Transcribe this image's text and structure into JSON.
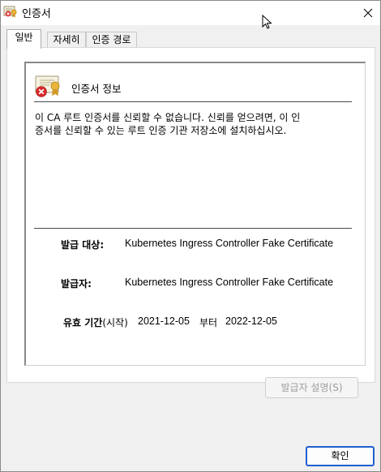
{
  "window": {
    "title": "인증서"
  },
  "tabs": [
    {
      "label": "일반",
      "active": true
    },
    {
      "label": "자세히",
      "active": false
    },
    {
      "label": "인증 경로",
      "active": false
    }
  ],
  "certificate": {
    "info_title": "인증서 정보",
    "warning_lines": [
      "이 CA 루트 인증서를 신뢰할 수 없습니다. 신뢰를 얻으려면, 이 인",
      "증서를 신뢰할 수 있는 루트 인증 기관 저장소에 설치하십시오."
    ],
    "issued_to_label": "발급 대상:",
    "issued_to_value": "Kubernetes Ingress Controller Fake Certificate",
    "issued_by_label": "발급자:",
    "issued_by_value": "Kubernetes Ingress Controller Fake Certificate",
    "validity_label": "유효 기간",
    "validity_from_suffix": "(시작)",
    "valid_from": "2021-12-05",
    "to_word": "부터",
    "valid_to": "2022-12-05"
  },
  "buttons": {
    "issuer_statement": "발급자 설명(S)",
    "ok": "확인"
  },
  "colors": {
    "accent": "#1f5fcf",
    "error_red": "#d8282a",
    "disabled_text": "#9d9d9d"
  },
  "icons": [
    "certificate-icon",
    "close-icon",
    "certificate-error-icon",
    "mouse-cursor-icon"
  ]
}
